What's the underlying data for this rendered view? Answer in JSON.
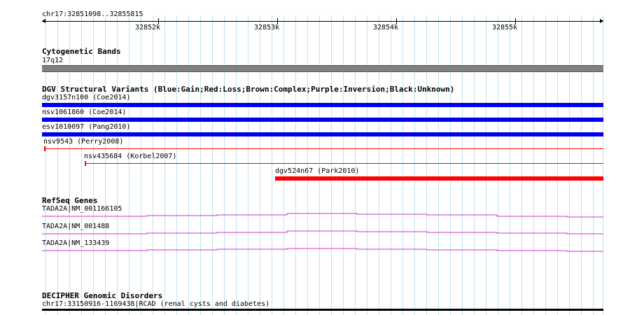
{
  "ruler": {
    "region": "chr17:32851098..32855815",
    "ticks": [
      "32852k",
      "32853k",
      "32854k",
      "32855k"
    ]
  },
  "cytoband": {
    "title": "Cytogenetic Bands",
    "band": "17q12",
    "color": "#808080"
  },
  "dgv": {
    "title": "DGV Structural Variants (Blue:Gain;Red:Loss;Brown:Complex;Purple:Inversion;Black:Unknown)",
    "variants": [
      {
        "label": "dgv3157n100 (Coe2014)",
        "color": "#0000ee"
      },
      {
        "label": "nsv1061860 (Coe2014)",
        "color": "#0000ee"
      },
      {
        "label": "esv1010097 (Pang2010)",
        "color": "#0000ee"
      },
      {
        "label": "nsv9543 (Perry2008)",
        "color": "#ff0000"
      },
      {
        "label": "nsv435684 (Korbel2007)",
        "color": "#ff0000"
      },
      {
        "label": "dgv524n67 (Park2010)",
        "color": "#ff0000"
      }
    ]
  },
  "refseq": {
    "title": "RefSeq Genes",
    "color": "#cc33cc",
    "genes": [
      {
        "label": "TADA2A|NM_001166105"
      },
      {
        "label": "TADA2A|NM_001488"
      },
      {
        "label": "TADA2A|NM_133439"
      }
    ]
  },
  "decipher": {
    "title": "DECIPHER Genomic Disorders",
    "region": "chr17:33150916-1169438|RCAD (renal cysts and diabetes)",
    "color": "#000000"
  }
}
